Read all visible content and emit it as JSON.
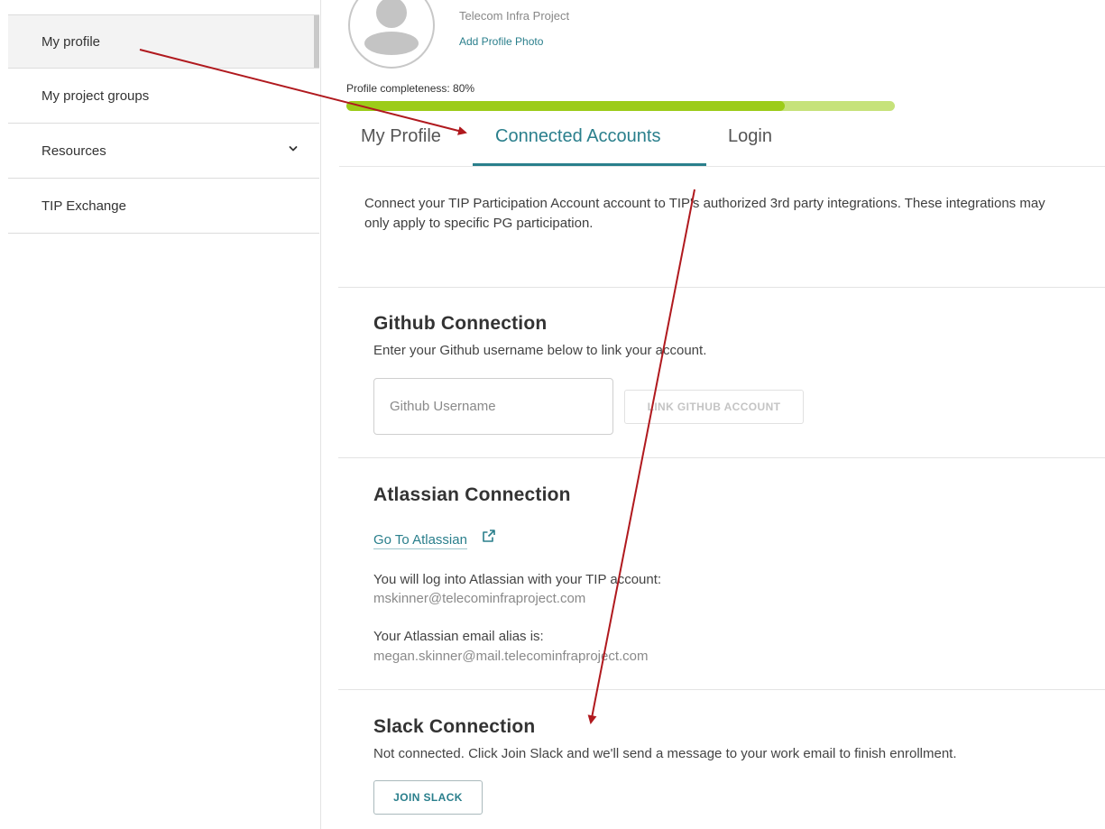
{
  "sidebar": {
    "items": [
      {
        "label": "My profile"
      },
      {
        "label": "My project groups"
      },
      {
        "label": "Resources"
      },
      {
        "label": "TIP Exchange"
      }
    ]
  },
  "profile": {
    "organization": "Telecom Infra Project",
    "add_photo": "Add Profile Photo",
    "completeness_label": "Profile completeness: 80%",
    "completeness_percent": 80
  },
  "tabs": [
    {
      "label": "My Profile"
    },
    {
      "label": "Connected Accounts"
    },
    {
      "label": "Login"
    }
  ],
  "intro": "Connect your TIP Participation Account account to TIP's authorized 3rd party integrations. These integrations may only apply to specific PG participation.",
  "github": {
    "title": "Github Connection",
    "description": "Enter your Github username below to link your account.",
    "input_placeholder": "Github Username",
    "input_value": "",
    "button_label": "LINK GITHUB ACCOUNT"
  },
  "atlassian": {
    "title": "Atlassian Connection",
    "link_label": "Go To Atlassian",
    "login_text": "You will log into Atlassian with your TIP account:",
    "login_email": "mskinner@telecominfraproject.com",
    "alias_text": "Your Atlassian email alias is:",
    "alias_email": "megan.skinner@mail.telecominfraproject.com"
  },
  "slack": {
    "title": "Slack Connection",
    "description": "Not connected. Click Join Slack and we'll send a message to your work email to finish enrollment.",
    "button_label": "JOIN SLACK"
  },
  "colors": {
    "accent": "#2a7f8c",
    "progress_fill": "#9ccc19",
    "progress_track": "#c6e27a",
    "annotation_arrow": "#b0191e"
  }
}
